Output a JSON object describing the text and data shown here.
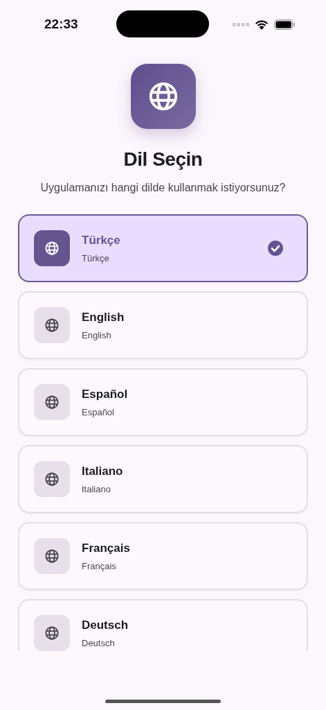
{
  "status_bar": {
    "time": "22:33"
  },
  "title": "Dil Seçin",
  "subtitle": "Uygulamanızı hangi dilde kullanmak istiyorsunuz?",
  "languages": [
    {
      "name": "Türkçe",
      "native": "Türkçe",
      "selected": true
    },
    {
      "name": "English",
      "native": "English",
      "selected": false
    },
    {
      "name": "Español",
      "native": "Español",
      "selected": false
    },
    {
      "name": "Italiano",
      "native": "Italiano",
      "selected": false
    },
    {
      "name": "Français",
      "native": "Français",
      "selected": false
    },
    {
      "name": "Deutsch",
      "native": "Deutsch",
      "selected": false
    }
  ]
}
